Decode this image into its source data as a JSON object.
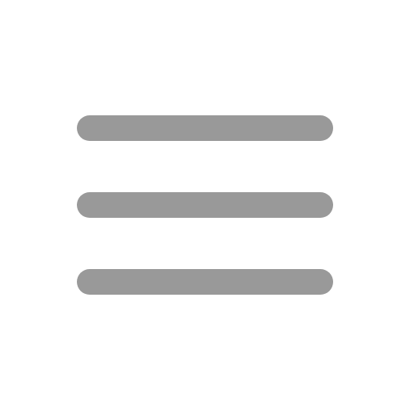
{
  "icon": {
    "name": "hamburger-menu-icon",
    "color": "#999999",
    "background": "#ffffff"
  }
}
